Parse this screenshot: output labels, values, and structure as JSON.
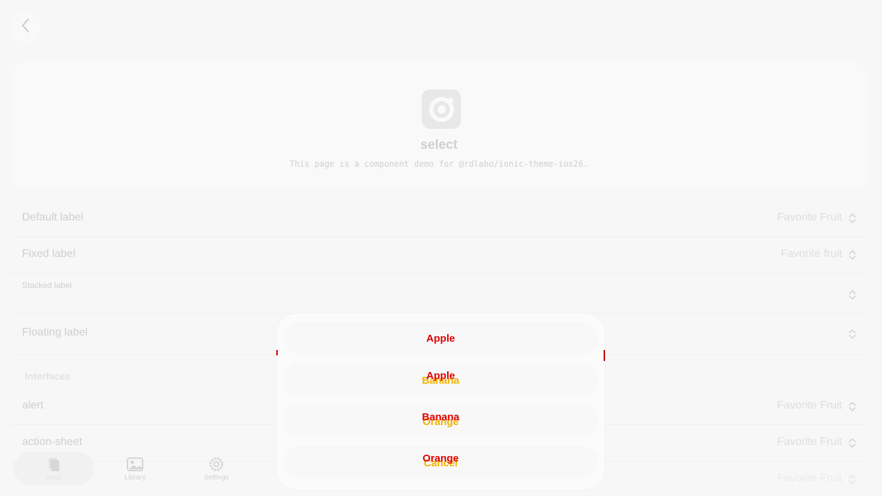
{
  "header": {
    "back_icon": "chevron-left-icon"
  },
  "hero": {
    "logo_icon": "ionic-logo-icon",
    "title": "select",
    "description": "This page is a component demo for @rdlabo/ionic-theme-ios26."
  },
  "selects": [
    {
      "label": "Default label",
      "value": "Favorite Fruit"
    },
    {
      "label": "Fixed label",
      "value": "Favorite fruit"
    },
    {
      "label": "Stacked label",
      "value": ""
    },
    {
      "label": "Floating label",
      "value": ""
    }
  ],
  "interfaces": {
    "header": "Interfaces",
    "rows": [
      {
        "label": "alert",
        "value": "Favorite Fruit"
      },
      {
        "label": "action-sheet",
        "value": "Favorite Fruit"
      },
      {
        "label": "",
        "value": "Favorite Fruit"
      }
    ]
  },
  "tabbar": {
    "tabs": [
      {
        "label": "Inbox",
        "icon": "inbox-icon",
        "active": true
      },
      {
        "label": "Library",
        "icon": "library-icon",
        "active": false
      },
      {
        "label": "Settings",
        "icon": "settings-icon",
        "active": false
      }
    ]
  },
  "action_sheet": {
    "options": [
      {
        "primary": "Apple",
        "ghost": ""
      },
      {
        "primary": "Apple",
        "ghost": "Banana"
      },
      {
        "primary": "Banana",
        "ghost": "Orange"
      },
      {
        "primary": "Orange",
        "ghost": "Cancel"
      }
    ],
    "colors": {
      "text_primary": "#e20000",
      "text_secondary": "#f0b400"
    }
  }
}
